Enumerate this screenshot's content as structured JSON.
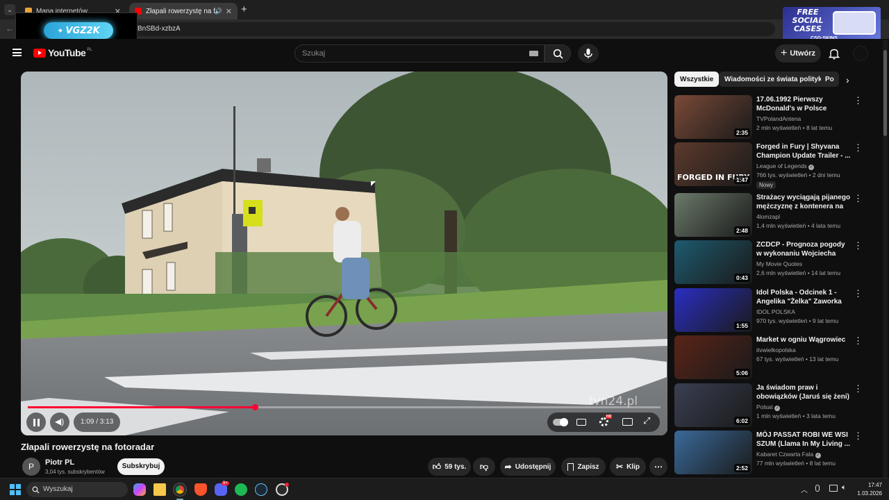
{
  "browser": {
    "tabs": [
      {
        "label": "Mapa internetów",
        "active": false
      },
      {
        "label": "Złapali rowerzystę na fotora",
        "active": true
      }
    ],
    "url_fragment": "BnSBd-xzbzA"
  },
  "overlay": {
    "stream_logo": "VGZ2K",
    "ad_line1": "FREE",
    "ad_line2": "SOCIAL",
    "ad_line3": "CASES",
    "ad_brand": "CSG·SKINS"
  },
  "header": {
    "logo_text": "YouTube",
    "logo_region": "PL",
    "search_placeholder": "Szukaj",
    "create_label": "Utwórz"
  },
  "player": {
    "watermark": "tvn24.pl",
    "time": "1:09 / 3:13",
    "progress": 0.36,
    "hd_badge": "HD"
  },
  "video": {
    "title": "Złapali rowerzystę na fotoradar",
    "channel": "Piotr PL",
    "avatar_letter": "P",
    "subscribers": "3,04 tys. subskrybentów",
    "subscribe_label": "Subskrybuj",
    "likes": "59 tys.",
    "share_label": "Udostępnij",
    "save_label": "Zapisz",
    "clip_label": "Klip"
  },
  "chips": [
    "Wszystkie",
    "Wiadomości ze świata polityki",
    "Po"
  ],
  "recommendations": [
    {
      "title": "17.06.1992 Pierwszy McDonald's w Polsce",
      "channel": "TVPolandAntena",
      "meta": "2 mln wyświetleń • 8 lat temu",
      "duration": "2:35",
      "thumb": "#7a4a38"
    },
    {
      "title": "Forged in Fury | Shyvana Champion Update Trailer - ...",
      "channel": "League of Legends",
      "verified": true,
      "meta": "766 tys. wyświetleń • 2 dni temu",
      "duration": "1:47",
      "badge": "Nowy",
      "thumb_text": "FORGED IN FURY",
      "thumb": "#5c3a2c"
    },
    {
      "title": "Strażacy wyciągają pijanego mężczyznę z kontenera na ...",
      "channel": "4lomzapl",
      "meta": "1,4 mln wyświetleń • 4 lata temu",
      "duration": "2:48",
      "thumb": "#6b7a6a"
    },
    {
      "title": "ZCDCP - Prognoza pogody w wykonaniu Wojciecha Manna ...",
      "channel": "My Movie Quotes",
      "meta": "2,6 mln wyświetleń • 14 lat temu",
      "duration": "0:43",
      "thumb": "#1e5a6e"
    },
    {
      "title": "Idol Polska - Odcinek 1 - Angelika \"Żelka\" Zaworka",
      "channel": "IDOL POLSKA",
      "meta": "970 tys. wyświetleń • 9 lat temu",
      "duration": "1:55",
      "thumb": "#2a2ec2"
    },
    {
      "title": "Market w ogniu Wągrowiec",
      "channel": "itvwielkopolska",
      "meta": "67 tys. wyświetleń • 13 lat temu",
      "duration": "5:06",
      "thumb": "#5a2418"
    },
    {
      "title": "Ja świadom praw i obowiązków (Jaruś się żeni) | Chłopaki do ...",
      "channel": "Polsat",
      "verified": true,
      "meta": "1 mln wyświetleń • 3 lata temu",
      "duration": "6:02",
      "thumb": "#3a3f52"
    },
    {
      "title": "MÓJ PASSAT ROBI WE WSI SZUM (Llama In My Living ...",
      "channel": "Kabaret Czwarta Fala",
      "verified": true,
      "meta": "77 mln wyświetleń • 8 lat temu",
      "duration": "2:52",
      "thumb": "#3a6a9a"
    }
  ],
  "taskbar": {
    "search_placeholder": "Wyszukaj",
    "time": "17:47",
    "date": "1.03.2026",
    "discord_badge": "9+"
  }
}
